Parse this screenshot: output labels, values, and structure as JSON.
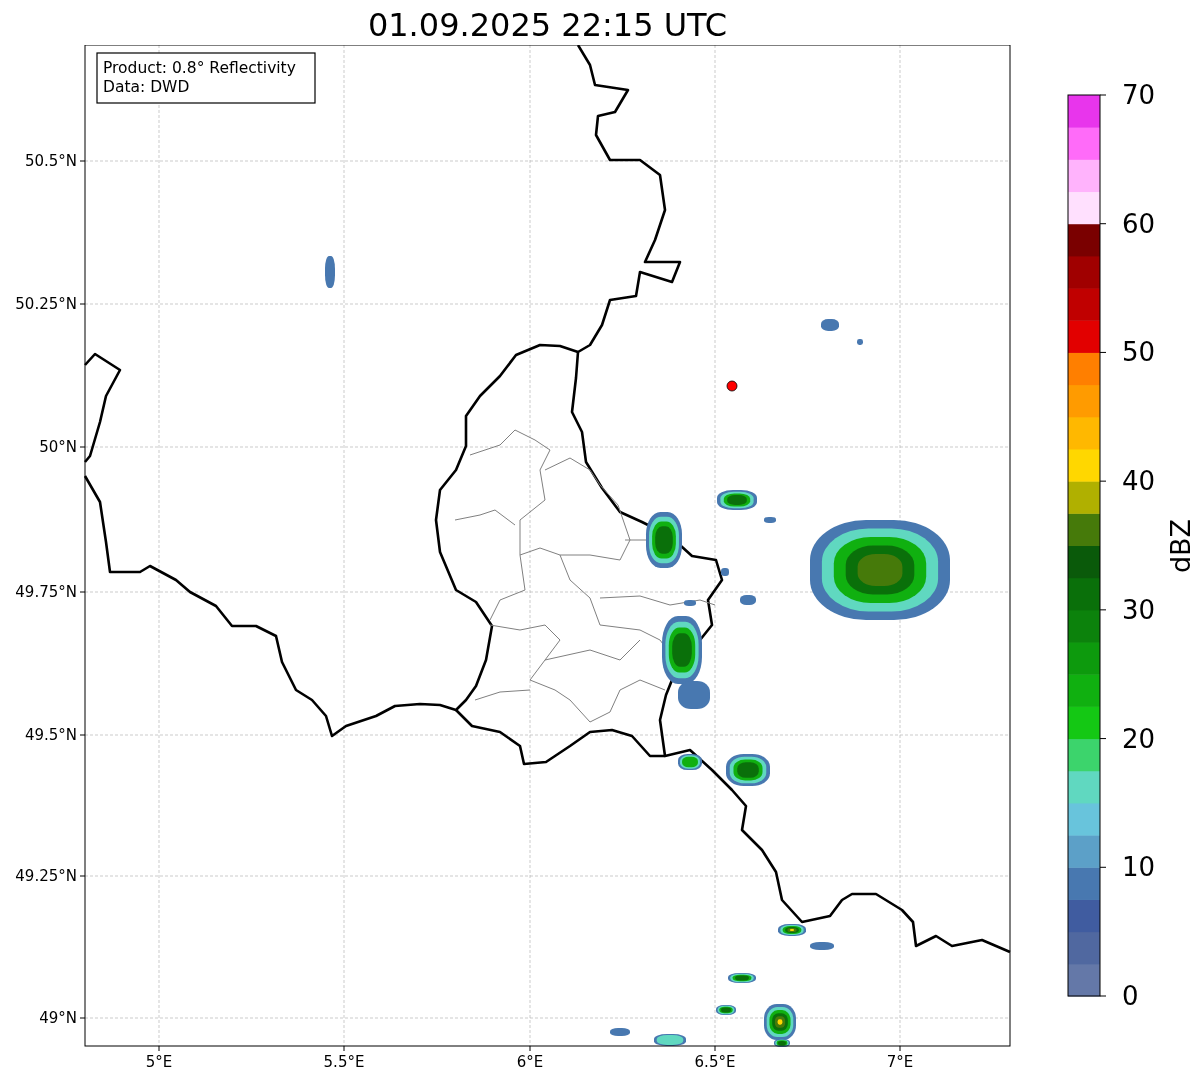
{
  "title": "01.09.2025 22:15 UTC",
  "info_box": [
    "Product: 0.8° Reflectivity",
    "Data: DWD"
  ],
  "map": {
    "x_ticks": [
      "5°E",
      "5.5°E",
      "6°E",
      "6.5°E",
      "7°E"
    ],
    "y_ticks": [
      "50.5°N",
      "50.25°N",
      "50°N",
      "49.75°N",
      "49.5°N",
      "49.25°N",
      "49°N"
    ]
  },
  "colorbar": {
    "label": "dBZ",
    "ticks": [
      "70",
      "60",
      "50",
      "40",
      "30",
      "20",
      "10",
      "0"
    ],
    "bins": [
      {
        "color": "#6478a8"
      },
      {
        "color": "#5068a0"
      },
      {
        "color": "#405ca0"
      },
      {
        "color": "#4878b0"
      },
      {
        "color": "#5ca0c8"
      },
      {
        "color": "#68c4dc"
      },
      {
        "color": "#60d8c0"
      },
      {
        "color": "#3cd46c"
      },
      {
        "color": "#14c814"
      },
      {
        "color": "#10b010"
      },
      {
        "color": "#0d9a0d"
      },
      {
        "color": "#0c820c"
      },
      {
        "color": "#0a700a"
      },
      {
        "color": "#0a5a0a"
      },
      {
        "color": "#467a0a"
      },
      {
        "color": "#b0b000"
      },
      {
        "color": "#ffd700"
      },
      {
        "color": "#ffb800"
      },
      {
        "color": "#ff9b00"
      },
      {
        "color": "#ff7f00"
      },
      {
        "color": "#e20000"
      },
      {
        "color": "#c00000"
      },
      {
        "color": "#a00000"
      },
      {
        "color": "#7a0000"
      },
      {
        "color": "#ffe0fe"
      },
      {
        "color": "#ffb3fc"
      },
      {
        "color": "#ff6bf9"
      },
      {
        "color": "#e835ec"
      }
    ]
  }
}
